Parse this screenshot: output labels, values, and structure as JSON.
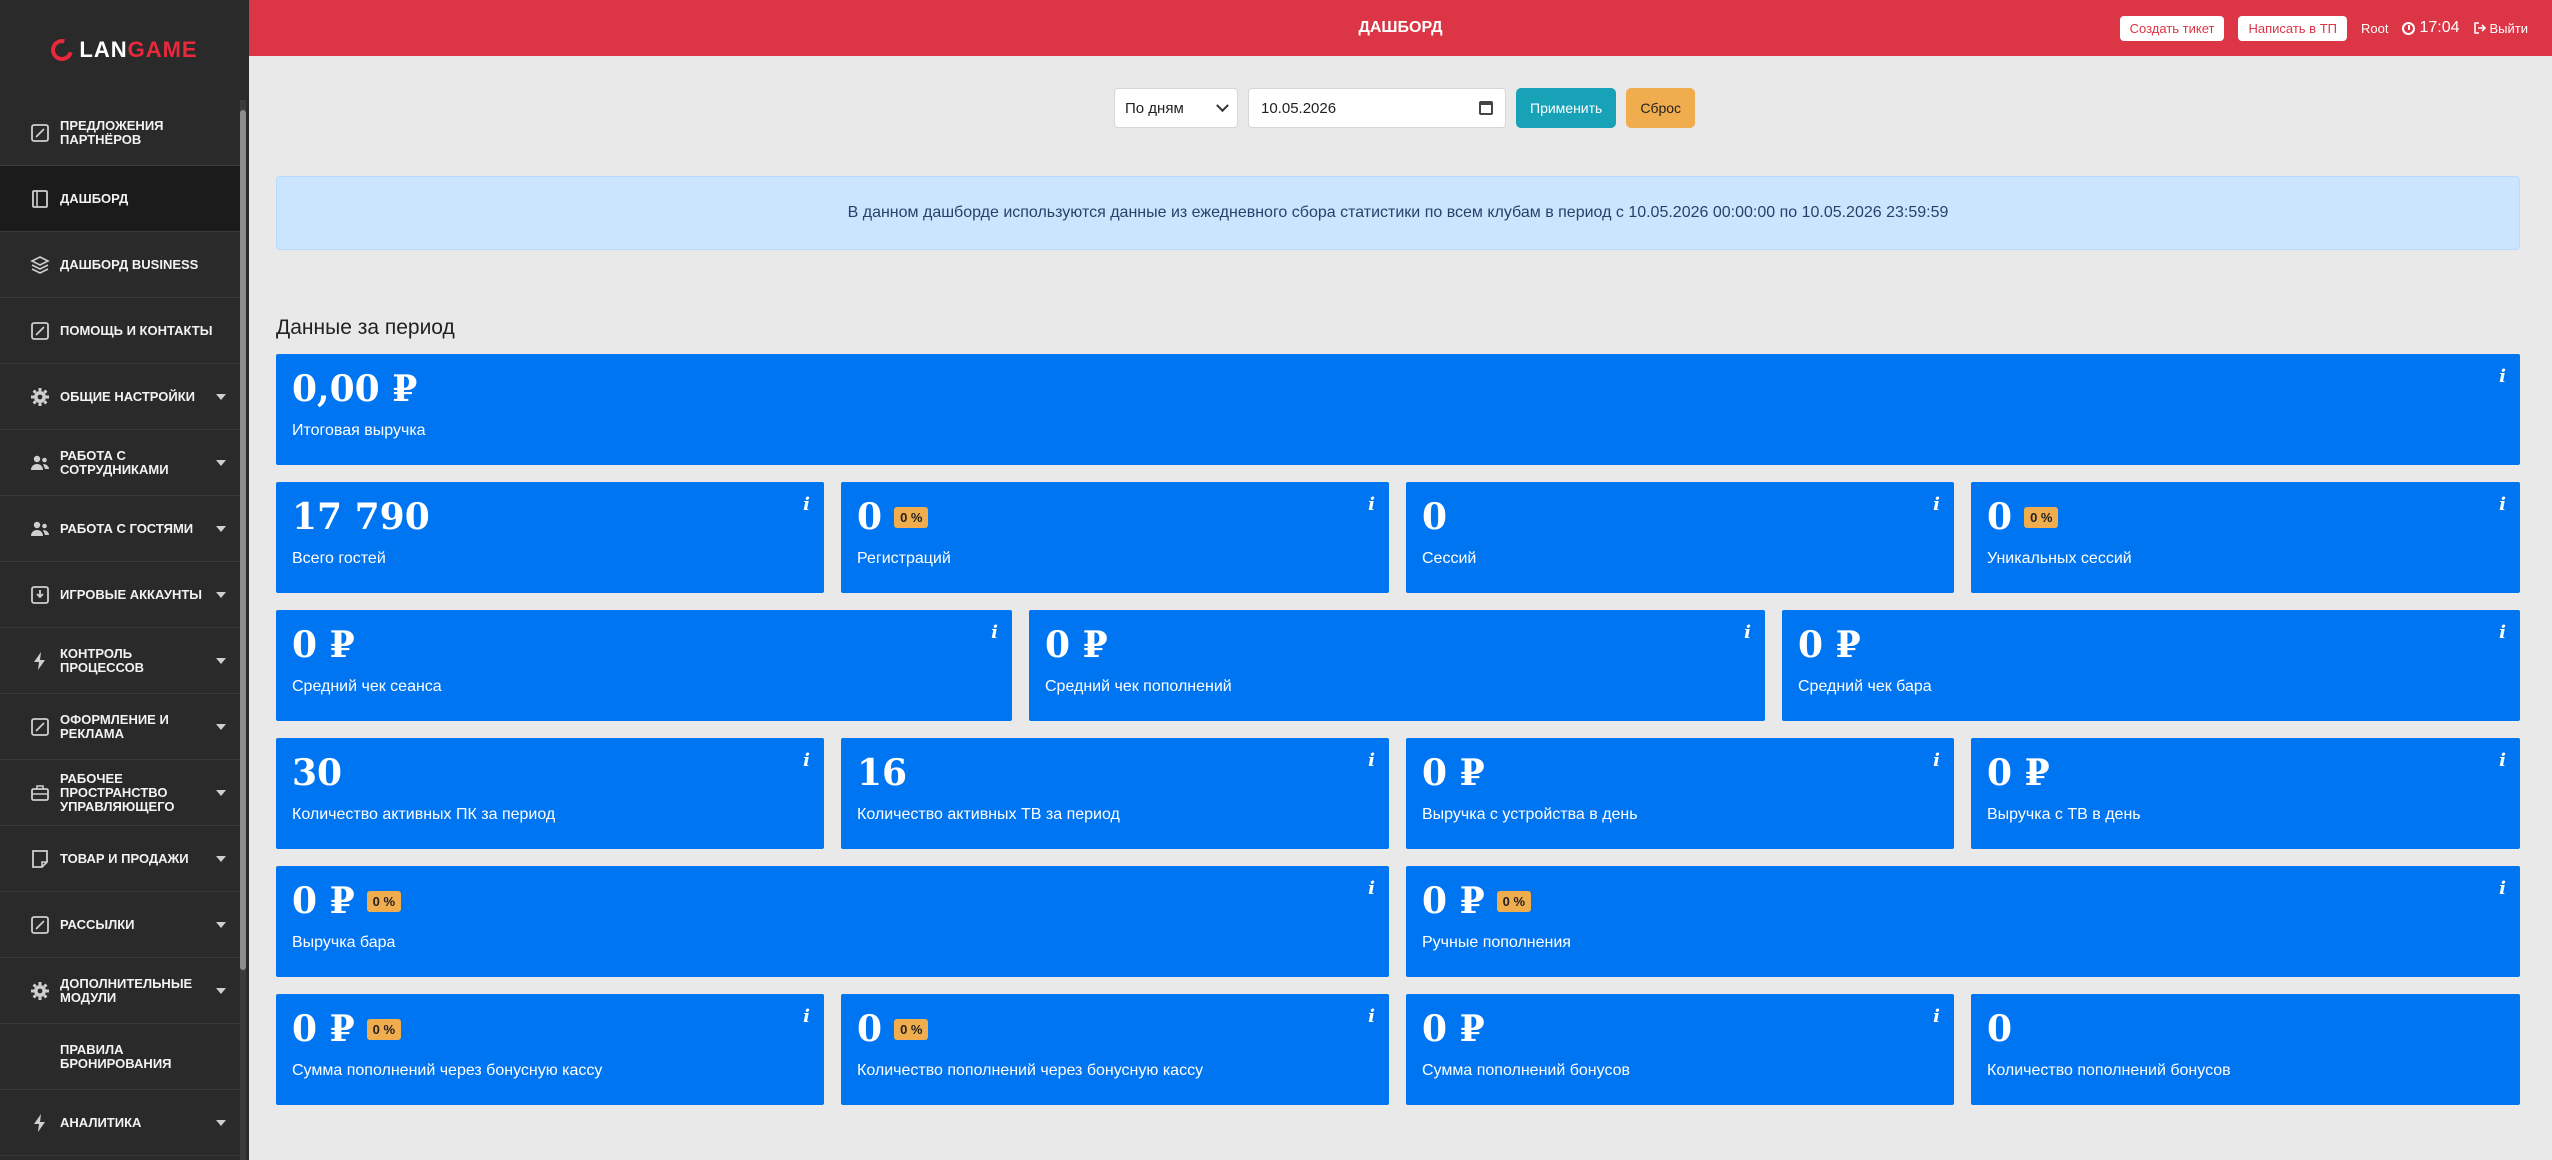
{
  "brand": {
    "logo_text_a": "LAN",
    "logo_text_b": "GAME"
  },
  "sidebar": {
    "items": [
      {
        "label": "Предложения партнёров",
        "icon": "edit-icon",
        "caret": false,
        "active": false
      },
      {
        "label": "Дашборд",
        "icon": "dashboard-icon",
        "caret": false,
        "active": true
      },
      {
        "label": "Дашборд Business",
        "icon": "layers-icon",
        "caret": false,
        "active": false
      },
      {
        "label": "Помощь и контакты",
        "icon": "edit-icon",
        "caret": false,
        "active": false
      },
      {
        "label": "Общие настройки",
        "icon": "gear-icon",
        "caret": true,
        "active": false
      },
      {
        "label": "Работа с сотрудниками",
        "icon": "users-icon",
        "caret": true,
        "active": false
      },
      {
        "label": "Работа с гостями",
        "icon": "users-icon",
        "caret": true,
        "active": false
      },
      {
        "label": "Игровые аккаунты",
        "icon": "download-icon",
        "caret": true,
        "active": false
      },
      {
        "label": "Контроль процессов",
        "icon": "lightning-icon",
        "caret": true,
        "active": false
      },
      {
        "label": "Оформление и реклама",
        "icon": "edit-icon",
        "caret": true,
        "active": false
      },
      {
        "label": "Рабочее пространство управляющего",
        "icon": "briefcase-icon",
        "caret": true,
        "active": false
      },
      {
        "label": "Товар и продажи",
        "icon": "note-icon",
        "caret": true,
        "active": false
      },
      {
        "label": "Рассылки",
        "icon": "edit-icon",
        "caret": true,
        "active": false
      },
      {
        "label": "Дополнительные модули",
        "icon": "gear-icon",
        "caret": true,
        "active": false
      },
      {
        "label": "Правила бронирования",
        "icon": "",
        "caret": false,
        "active": false
      },
      {
        "label": "Аналитика",
        "icon": "lightning-icon",
        "caret": true,
        "active": false
      }
    ]
  },
  "header": {
    "title": "ДАШБОРД",
    "create_ticket": "Создать тикет",
    "write_support": "Написать в ТП",
    "user": "Root",
    "time": "17:04",
    "logout": "Выйти"
  },
  "filters": {
    "period_value": "По дням",
    "date_value": "10.05.2026",
    "apply_label": "Применить",
    "reset_label": "Сброс"
  },
  "alert": {
    "text": "В данном дашборде используются данные из ежедневного сбора статистики по всем клубам в период с 10.05.2026 00:00:00 по 10.05.2026 23:59:59"
  },
  "section": {
    "title": "Данные за период"
  },
  "cards": {
    "total_revenue": {
      "value": "0,00 ₽",
      "label": "Итоговая выручка"
    },
    "guests": {
      "value": "17 790",
      "label": "Всего гостей"
    },
    "registrations": {
      "value": "0",
      "badge": "0 %",
      "label": "Регистраций"
    },
    "sessions": {
      "value": "0",
      "label": "Сессий"
    },
    "unique_sessions": {
      "value": "0",
      "badge": "0 %",
      "label": "Уникальных сессий"
    },
    "avg_session_check": {
      "value": "0 ₽",
      "label": "Средний чек сеанса"
    },
    "avg_topup_check": {
      "value": "0 ₽",
      "label": "Средний чек пополнений"
    },
    "avg_bar_check": {
      "value": "0 ₽",
      "label": "Средний чек бара"
    },
    "active_pc": {
      "value": "30",
      "label": "Количество активных ПК за период"
    },
    "active_tv": {
      "value": "16",
      "label": "Количество активных ТВ за период"
    },
    "revenue_per_device": {
      "value": "0 ₽",
      "label": "Выручка с устройства в день"
    },
    "revenue_per_tv": {
      "value": "0 ₽",
      "label": "Выручка с ТВ в день"
    },
    "bar_revenue": {
      "value": "0 ₽",
      "badge": "0 %",
      "label": "Выручка бара"
    },
    "manual_topups": {
      "value": "0 ₽",
      "badge": "0 %",
      "label": "Ручные пополнения"
    },
    "bonus_cashbox_sum": {
      "value": "0 ₽",
      "badge": "0 %",
      "label": "Сумма пополнений через бонусную кассу"
    },
    "bonus_cashbox_count": {
      "value": "0",
      "badge": "0 %",
      "label": "Количество пополнений через бонусную кассу"
    },
    "bonus_topups_sum": {
      "value": "0 ₽",
      "label": "Сумма пополнений бонусов"
    },
    "bonus_topups_count": {
      "value": "0",
      "label": "Количество пополнений бонусов"
    }
  },
  "icons": {
    "info": "i"
  },
  "colors": {
    "header": "#dc3545",
    "sidebar": "#2a2a2a",
    "card": "#0075f2",
    "badge": "#f0ad4e",
    "apply": "#17a2b8",
    "reset": "#f0ad4e",
    "alert": "#cce5ff"
  }
}
